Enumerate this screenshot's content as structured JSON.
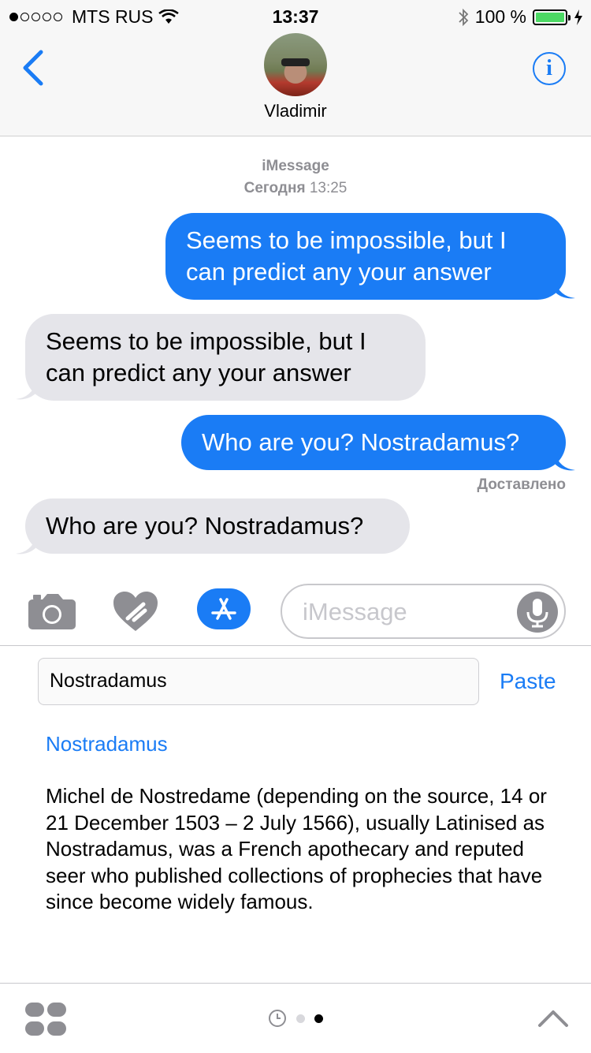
{
  "status": {
    "carrier": "MTS RUS",
    "time": "13:37",
    "battery": "100 %",
    "battery_level": 1.0,
    "signal_bars_filled": 1,
    "signal_bars_total": 5
  },
  "header": {
    "contact_name": "Vladimir",
    "back_icon": "chevron-left-icon",
    "info_icon": "info-icon",
    "info_glyph": "i"
  },
  "conversation": {
    "service": "iMessage",
    "date_label": "Сегодня",
    "date_time": "13:25",
    "messages": [
      {
        "direction": "out",
        "text": "Seems to be impossible, but I can predict any your answer"
      },
      {
        "direction": "in",
        "text": "Seems to be impossible, but I can predict any your answer"
      },
      {
        "direction": "out",
        "text": "Who are you? Nostradamus?"
      },
      {
        "direction": "in",
        "text": "Who are you? Nostradamus?"
      }
    ],
    "delivered_label": "Доставлено"
  },
  "composer": {
    "placeholder": "iMessage",
    "icons": [
      "camera-icon",
      "digital-touch-heart-icon",
      "app-store-icon",
      "microphone-icon"
    ]
  },
  "extension": {
    "search_value": "Nostradamus",
    "paste_label": "Paste",
    "result_title": "Nostradamus",
    "result_text": "Michel de Nostredame (depending on the source, 14 or 21 December 1503 – 2 July 1566), usually Latinised as Nostradamus, was a French apothecary and reputed seer who published collections of prophecies that have since become widely famous."
  },
  "bottom_bar": {
    "icons": [
      "app-drawer-icon",
      "recents-clock-icon",
      "chevron-up-icon"
    ],
    "page_count": 2,
    "active_page": 2
  },
  "colors": {
    "accent": "#1a7cf5",
    "incoming_bubble": "#e5e5ea",
    "battery_fill": "#4cd964",
    "secondary_text": "#8e8e93"
  }
}
